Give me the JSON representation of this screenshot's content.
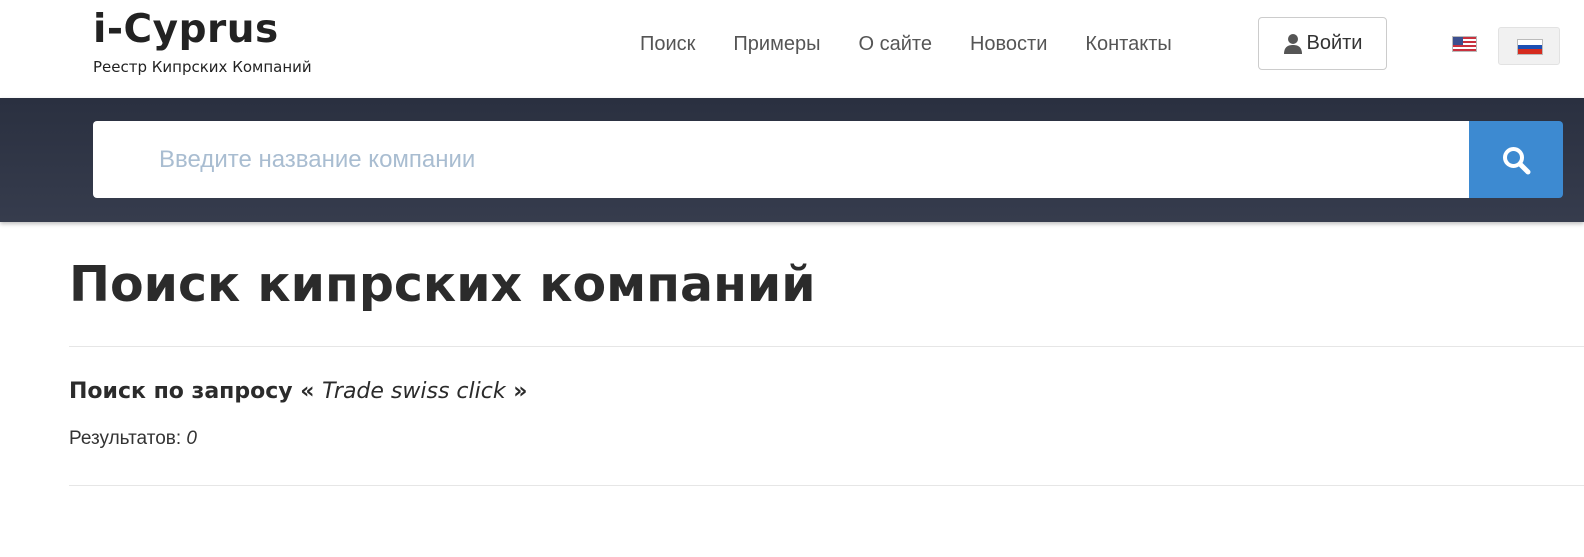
{
  "brand": {
    "title": "i-Cyprus",
    "subtitle": "Реестр Кипрских Компаний"
  },
  "nav": {
    "items": [
      {
        "label": "Поиск"
      },
      {
        "label": "Примеры"
      },
      {
        "label": "О сайте"
      },
      {
        "label": "Новости"
      },
      {
        "label": "Контакты"
      }
    ],
    "login_label": "Войти"
  },
  "languages": {
    "flags": [
      "us-flag",
      "ru-flag"
    ],
    "selected": "ru"
  },
  "search": {
    "placeholder": "Введите название компании",
    "value": "",
    "button_icon": "search-icon"
  },
  "main": {
    "page_title": "Поиск кипрских компаний",
    "query_prefix": "Поиск по запросу «",
    "query_term": "Trade swiss click",
    "query_suffix": "»",
    "results_label": "Результатов:",
    "results_count": "0"
  },
  "colors": {
    "search_band": "#2f3545",
    "search_button": "#3d8ad1",
    "placeholder": "#a9bdd1"
  }
}
